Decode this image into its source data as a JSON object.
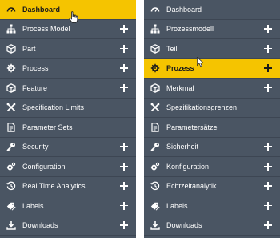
{
  "colors": {
    "sidebar_bg": "#4a5563",
    "active_bg": "#f5c400",
    "text": "#ffffff",
    "active_text": "#1b1b1b"
  },
  "left_menu": {
    "items": [
      {
        "label": "Dashboard",
        "icon": "dashboard-icon",
        "expandable": false,
        "active": true
      },
      {
        "label": "Process Model",
        "icon": "hierarchy-icon",
        "expandable": true,
        "active": false
      },
      {
        "label": "Part",
        "icon": "cube-icon",
        "expandable": true,
        "active": false
      },
      {
        "label": "Process",
        "icon": "process-gear-icon",
        "expandable": true,
        "active": false
      },
      {
        "label": "Feature",
        "icon": "feature-cube-icon",
        "expandable": true,
        "active": false
      },
      {
        "label": "Specification Limits",
        "icon": "tools-icon",
        "expandable": false,
        "active": false
      },
      {
        "label": "Parameter Sets",
        "icon": "document-icon",
        "expandable": false,
        "active": false
      },
      {
        "label": "Security",
        "icon": "key-icon",
        "expandable": true,
        "active": false
      },
      {
        "label": "Configuration",
        "icon": "gears-icon",
        "expandable": true,
        "active": false
      },
      {
        "label": "Real Time Analytics",
        "icon": "clock-icon",
        "expandable": true,
        "active": false
      },
      {
        "label": "Labels",
        "icon": "tags-icon",
        "expandable": true,
        "active": false
      },
      {
        "label": "Downloads",
        "icon": "download-icon",
        "expandable": true,
        "active": false
      }
    ]
  },
  "right_menu": {
    "items": [
      {
        "label": "Dashboard",
        "icon": "dashboard-icon",
        "expandable": false,
        "active": false
      },
      {
        "label": "Prozessmodell",
        "icon": "hierarchy-icon",
        "expandable": true,
        "active": false
      },
      {
        "label": "Teil",
        "icon": "cube-icon",
        "expandable": true,
        "active": false
      },
      {
        "label": "Prozess",
        "icon": "process-gear-icon",
        "expandable": true,
        "active": true
      },
      {
        "label": "Merkmal",
        "icon": "feature-cube-icon",
        "expandable": true,
        "active": false
      },
      {
        "label": "Spezifikationsgrenzen",
        "icon": "tools-icon",
        "expandable": false,
        "active": false
      },
      {
        "label": "Parametersätze",
        "icon": "document-icon",
        "expandable": false,
        "active": false
      },
      {
        "label": "Sicherheit",
        "icon": "key-icon",
        "expandable": true,
        "active": false
      },
      {
        "label": "Konfiguration",
        "icon": "gears-icon",
        "expandable": true,
        "active": false
      },
      {
        "label": "Echtzeitanalytik",
        "icon": "clock-icon",
        "expandable": true,
        "active": false
      },
      {
        "label": "Labels",
        "icon": "tags-icon",
        "expandable": true,
        "active": false
      },
      {
        "label": "Downloads",
        "icon": "download-icon",
        "expandable": true,
        "active": false
      }
    ]
  }
}
